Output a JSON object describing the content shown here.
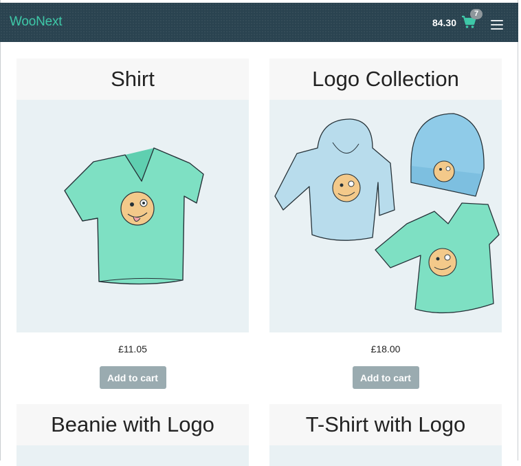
{
  "header": {
    "brand": "WooNext",
    "cart_total": "84.30",
    "cart_count": "7",
    "cart_icon": "shopping-cart-icon",
    "menu_icon": "hamburger-menu-icon"
  },
  "colors": {
    "navbar": "#2a4350",
    "brand": "#3ec8a8",
    "button": "#9aabb0",
    "title_bg": "#f7f7f7"
  },
  "products": [
    {
      "title": "Shirt",
      "price": "£11.05",
      "button": "Add to cart"
    },
    {
      "title": "Logo Collection",
      "price": "£18.00",
      "button": "Add to cart"
    },
    {
      "title": "Beanie with Logo"
    },
    {
      "title": "T-Shirt with Logo"
    }
  ]
}
